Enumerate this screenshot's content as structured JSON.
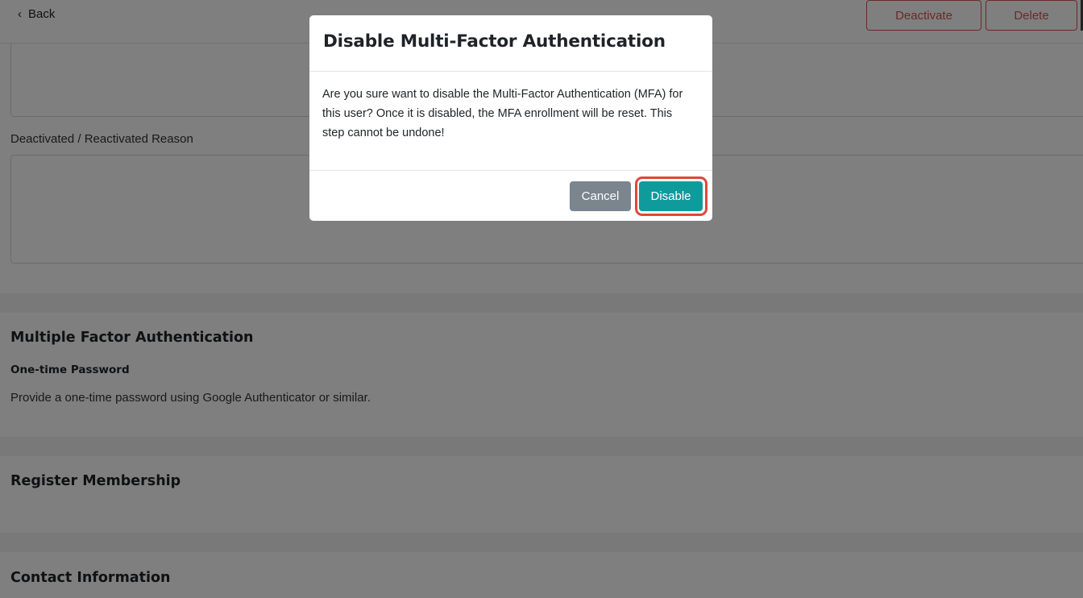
{
  "header": {
    "back_label": "Back",
    "back_icon": "chevron-left-icon",
    "deactivate_label": "Deactivate",
    "delete_label": "Delete"
  },
  "profile": {
    "reason_label": "Deactivated / Reactivated Reason"
  },
  "mfa_section": {
    "title": "Multiple Factor Authentication",
    "subtitle": "One-time Password",
    "description": "Provide a one-time password using Google Authenticator or similar."
  },
  "membership_section": {
    "title": "Register Membership"
  },
  "contact_section": {
    "title": "Contact Information"
  },
  "modal": {
    "title": "Disable Multi-Factor Authentication",
    "body": "Are you sure want to disable the Multi-Factor Authentication (MFA) for this user? Once it is disabled, the MFA enrollment will be reset. This step cannot be undone!",
    "cancel_label": "Cancel",
    "confirm_label": "Disable"
  },
  "colors": {
    "danger": "#d9534f",
    "primary_teal": "#0f9b9b",
    "secondary_gray": "#7a858e",
    "highlight": "#e0473a"
  }
}
